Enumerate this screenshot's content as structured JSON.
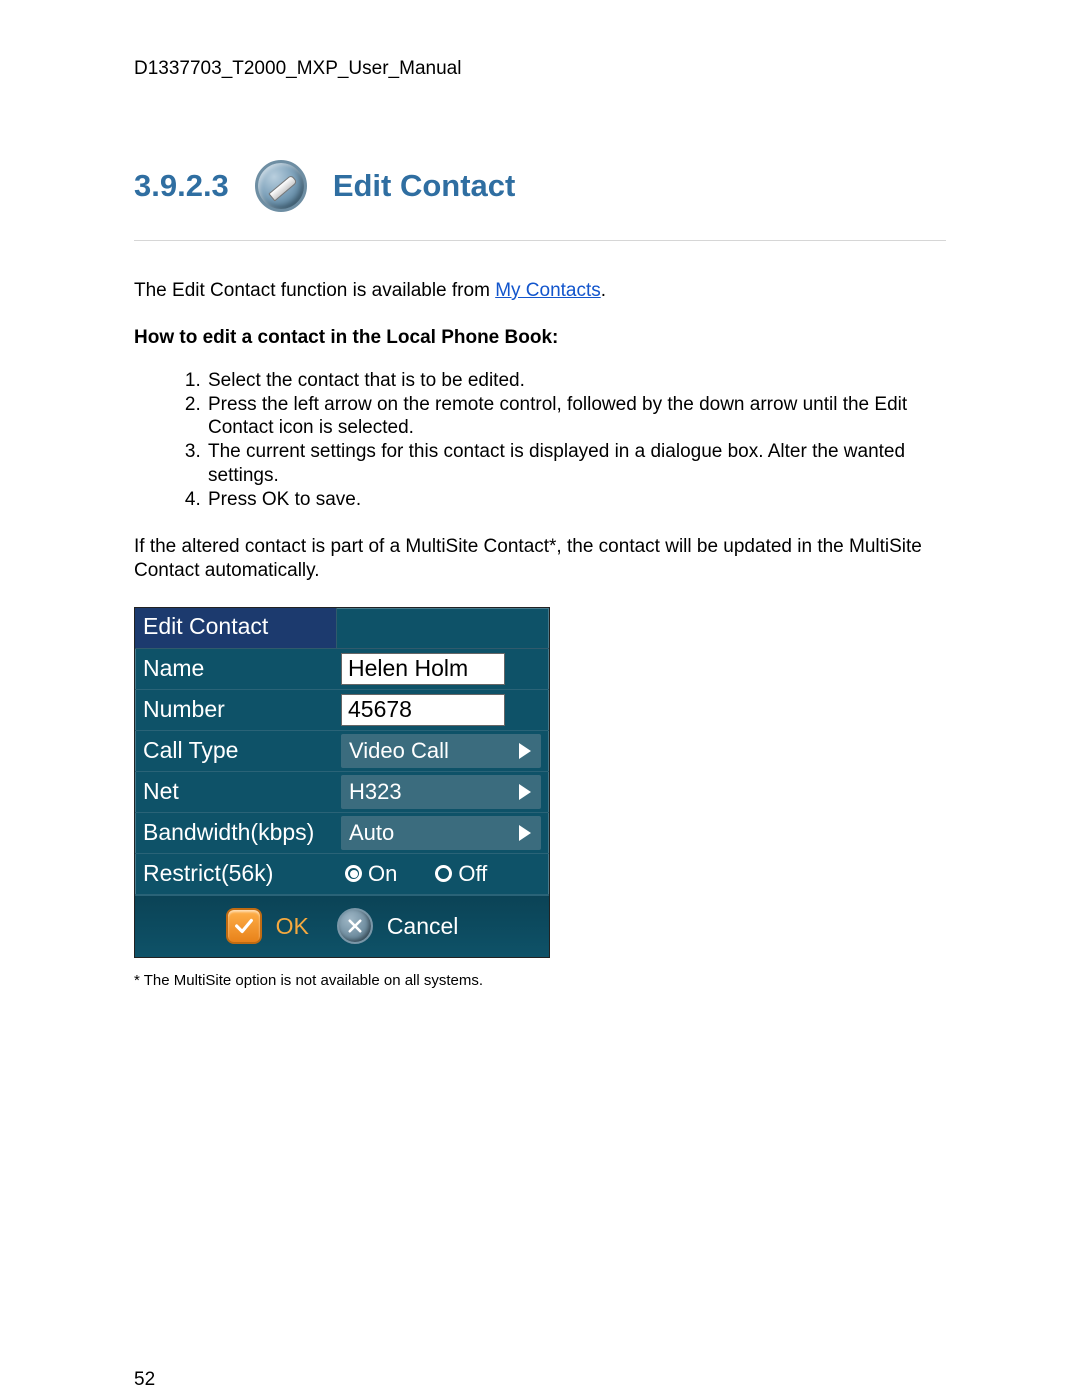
{
  "doc_header": "D1337703_T2000_MXP_User_Manual",
  "section_number": "3.9.2.3",
  "section_title": "Edit Contact",
  "intro_text_pre": "The Edit Contact function is available from ",
  "intro_link": "My Contacts",
  "intro_text_post": ".",
  "howto_heading": "How to edit a contact in the Local Phone Book:",
  "steps": [
    "Select the contact that is to be edited.",
    "Press the left arrow on the remote control, followed by the down arrow until the Edit Contact icon is selected.",
    "The current settings for this contact is displayed in a dialogue box. Alter the wanted settings.",
    "Press OK to save."
  ],
  "multisite_note": "If the altered contact is part of a MultiSite Contact*, the contact will be updated in the MultiSite Contact automatically.",
  "dialog": {
    "title": "Edit Contact",
    "fields": {
      "name_label": "Name",
      "name_value": "Helen Holm",
      "number_label": "Number",
      "number_value": "45678",
      "calltype_label": "Call Type",
      "calltype_value": "Video Call",
      "net_label": "Net",
      "net_value": "H323",
      "bandwidth_label": "Bandwidth(kbps)",
      "bandwidth_value": "Auto",
      "restrict_label": "Restrict(56k)",
      "restrict_on": "On",
      "restrict_off": "Off"
    },
    "ok_label": "OK",
    "cancel_label": "Cancel"
  },
  "footnote": "* The MultiSite option is not available on all systems.",
  "page_number": "52"
}
